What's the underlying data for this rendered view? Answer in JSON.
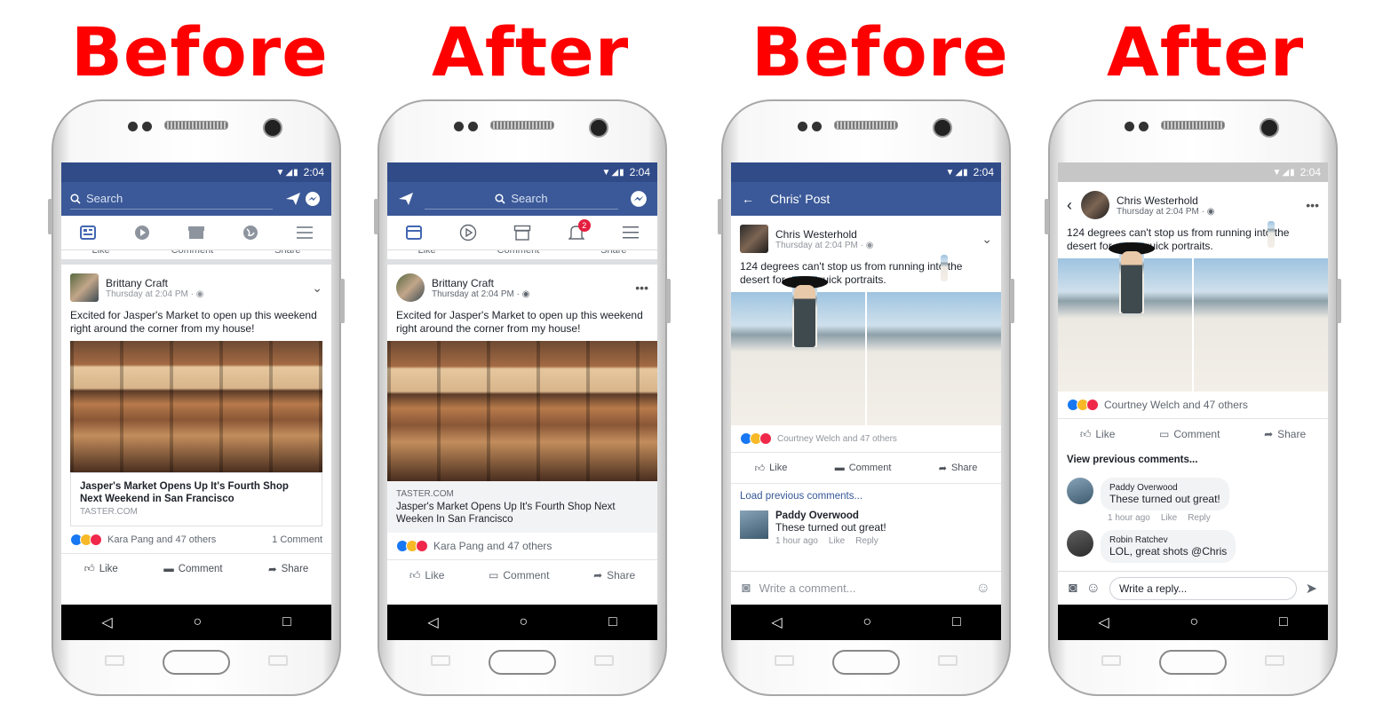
{
  "headings": [
    "Before",
    "After",
    "Before",
    "After"
  ],
  "status": {
    "time": "2:04"
  },
  "nav_buttons": {
    "back": "◁",
    "home": "○",
    "recent": "□"
  },
  "phone1": {
    "search_placeholder": "Search",
    "cut_actions": [
      "Like",
      "Comment",
      "Share"
    ],
    "author": "Brittany Craft",
    "time": "Thursday at 2:04 PM · ",
    "text": "Excited for Jasper's Market to open up this weekend right around the corner from my house!",
    "link_title": "Jasper's Market Opens Up It's Fourth Shop Next Weekend in San Francisco",
    "link_domain": "TASTER.COM",
    "reactions": "Kara Pang and 47 others",
    "comments": "1 Comment",
    "actions": [
      "Like",
      "Comment",
      "Share"
    ]
  },
  "phone2": {
    "search_placeholder": "Search",
    "badge": "2",
    "cut_actions": [
      "Like",
      "Comment",
      "Share"
    ],
    "author": "Brittany Craft",
    "time": "Thursday at 2:04 PM · ",
    "text": "Excited for Jasper's Market to open up this weekend right around the corner from my house!",
    "link_domain": "TASTER.COM",
    "link_title": "Jasper's Market Opens Up It's Fourth Shop Next Weeken In San Francisco",
    "reactions": "Kara Pang and 47 others",
    "actions": [
      "Like",
      "Comment",
      "Share"
    ]
  },
  "phone3": {
    "title": "Chris' Post",
    "author": "Chris Westerhold",
    "time": "Thursday at 2:04 PM · ",
    "text": "124 degrees can't stop us from running into the desert for some quick portraits.",
    "reactions": "Courtney Welch and 47 others",
    "actions": [
      "Like",
      "Comment",
      "Share"
    ],
    "load_prev": "Load previous comments...",
    "comment_name": "Paddy Overwood",
    "comment_text": "These turned out great!",
    "comment_meta": [
      "1 hour ago",
      "Like",
      "Reply"
    ],
    "composer": "Write a comment..."
  },
  "phone4": {
    "author": "Chris Westerhold",
    "time": "Thursday at 2:04 PM · ",
    "text": "124 degrees can't stop us from running into the desert for some quick portraits.",
    "reactions": "Courtney Welch and 47 others",
    "actions": [
      "Like",
      "Comment",
      "Share"
    ],
    "view_prev": "View previous comments...",
    "c1_name": "Paddy Overwood",
    "c1_text": "These turned out great!",
    "c1_meta": [
      "1 hour ago",
      "Like",
      "Reply"
    ],
    "c2_name": "Robin Ratchev",
    "c2_text": "LOL, great shots @Chris",
    "composer": "Write a reply..."
  }
}
